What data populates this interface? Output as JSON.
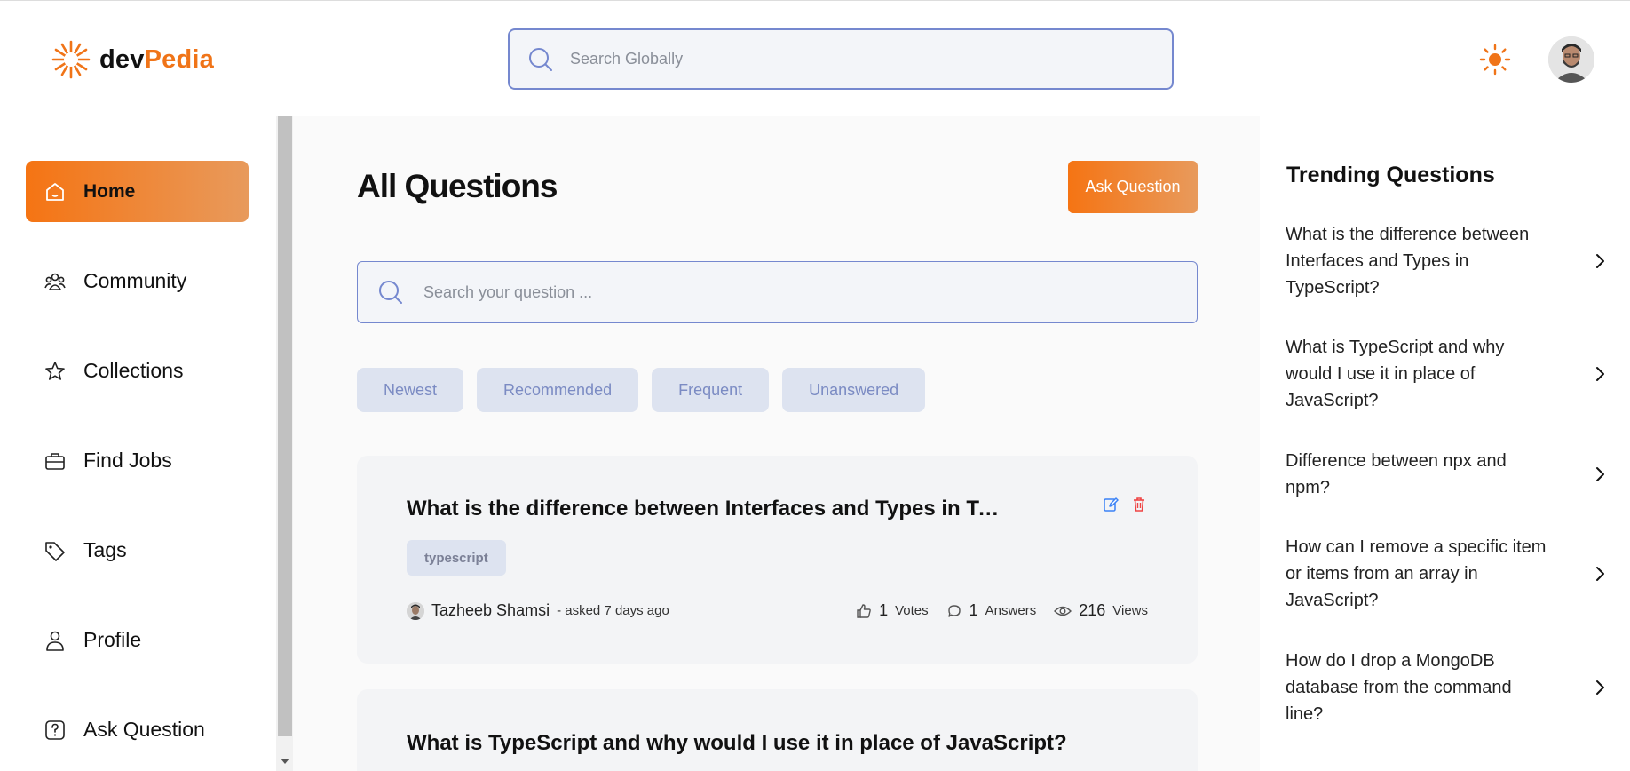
{
  "brand": {
    "name_part1": "dev",
    "name_part2": "Pedia",
    "accent": "#f07418"
  },
  "header": {
    "search_placeholder": "Search Globally",
    "theme_icon": "sun-icon",
    "avatar": "user-avatar"
  },
  "sidebar": {
    "items": [
      {
        "label": "Home",
        "icon": "home-icon",
        "active": true
      },
      {
        "label": "Community",
        "icon": "users-icon",
        "active": false
      },
      {
        "label": "Collections",
        "icon": "star-icon",
        "active": false
      },
      {
        "label": "Find Jobs",
        "icon": "briefcase-icon",
        "active": false
      },
      {
        "label": "Tags",
        "icon": "tag-icon",
        "active": false
      },
      {
        "label": "Profile",
        "icon": "user-icon",
        "active": false
      },
      {
        "label": "Ask Question",
        "icon": "question-icon",
        "active": false
      }
    ]
  },
  "main": {
    "title": "All Questions",
    "ask_button": "Ask Question",
    "search_placeholder": "Search your question ...",
    "filters": [
      "Newest",
      "Recommended",
      "Frequent",
      "Unanswered"
    ],
    "questions": [
      {
        "title": "What is the difference between Interfaces and Types in TypeScript?",
        "tags": [
          "typescript"
        ],
        "author": "Tazheeb Shamsi",
        "asked": "- asked 7 days ago",
        "votes": "1",
        "votes_label": "Votes",
        "answers": "1",
        "answers_label": "Answers",
        "views": "216",
        "views_label": "Views"
      },
      {
        "title": "What is TypeScript and why would I use it in place of JavaScript?"
      }
    ]
  },
  "trending": {
    "title": "Trending Questions",
    "items": [
      "What is the difference between Interfaces and Types in TypeScript?",
      "What is TypeScript and why would I use it in place of JavaScript?",
      "Difference between npx and npm?",
      "How can I remove a specific item or items from an array in JavaScript?",
      "How do I drop a MongoDB database from the command line?"
    ]
  }
}
